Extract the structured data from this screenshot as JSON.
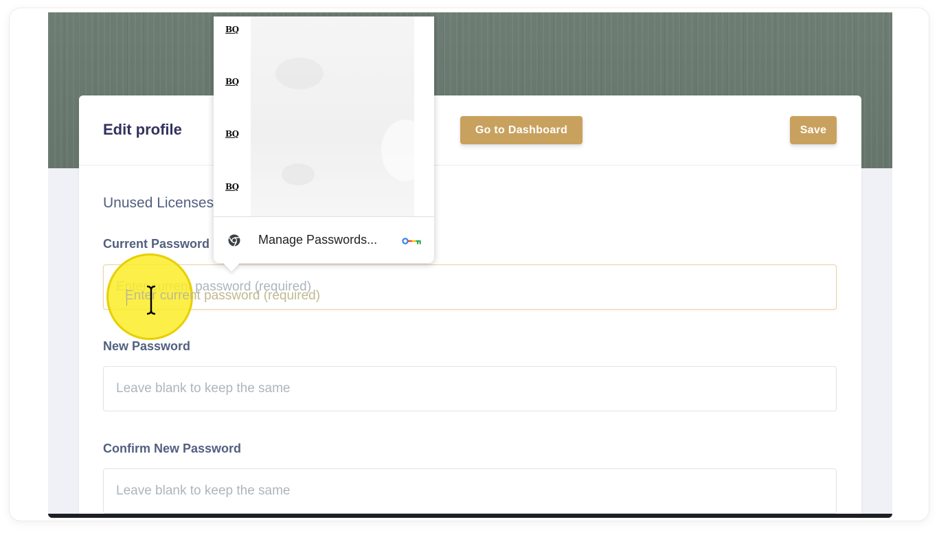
{
  "header": {
    "title": "Edit profile",
    "dashboard_label": "Go to Dashboard",
    "save_label": "Save"
  },
  "section": {
    "heading": "Unused Licenses"
  },
  "fields": {
    "current_password": {
      "label": "Current Password",
      "placeholder": "Enter current password (required)",
      "focused": true
    },
    "new_password": {
      "label": "New Password",
      "placeholder": "Leave blank to keep the same"
    },
    "confirm_password": {
      "label": "Confirm New Password",
      "placeholder": "Leave blank to keep the same"
    }
  },
  "autofill": {
    "entries": [
      {
        "logo": "BQ"
      },
      {
        "logo": "BQ"
      },
      {
        "logo": "BQ"
      },
      {
        "logo": "BQ"
      }
    ],
    "manage_label": "Manage Passwords...",
    "icons": [
      "chrome-icon",
      "password-key-icon"
    ]
  },
  "colors": {
    "accent": "#c9a15e",
    "hero": "#6a7a70",
    "title_text": "#32325d",
    "label_text": "#525f7f",
    "cursor_highlight": "#faec28"
  }
}
